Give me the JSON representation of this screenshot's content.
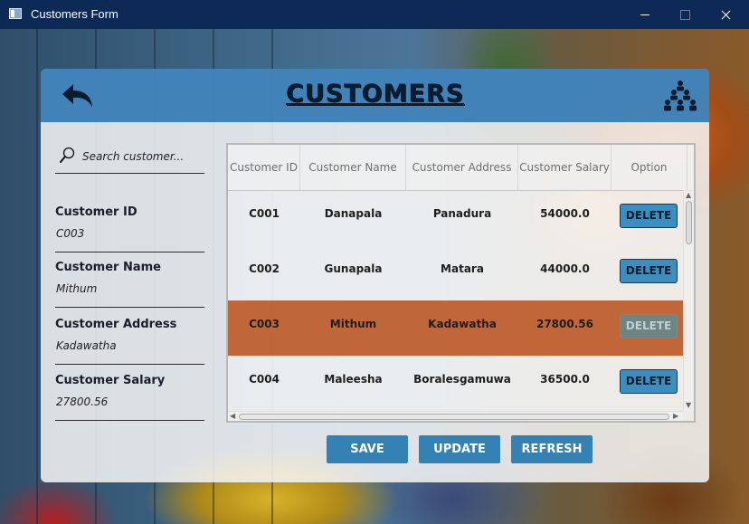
{
  "window": {
    "title": "Customers Form"
  },
  "header": {
    "title": "CUSTOMERS"
  },
  "search": {
    "placeholder": "Search customer..."
  },
  "form": {
    "id_label": "Customer ID",
    "id_value": "C003",
    "name_label": "Customer Name",
    "name_value": "Mithum",
    "address_label": "Customer Address",
    "address_value": "Kadawatha",
    "salary_label": "Customer Salary",
    "salary_value": "27800.56"
  },
  "table": {
    "columns": [
      "Customer ID",
      "Customer Name",
      "Customer Address",
      "Customer Salary",
      "Option"
    ],
    "rows": [
      {
        "id": "C001",
        "name": "Danapala",
        "address": "Panadura",
        "salary": "54000.0",
        "option": "DELETE"
      },
      {
        "id": "C002",
        "name": "Gunapala",
        "address": "Matara",
        "salary": "44000.0",
        "option": "DELETE"
      },
      {
        "id": "C003",
        "name": "Mithum",
        "address": "Kadawatha",
        "salary": "27800.56",
        "option": "DELETE"
      },
      {
        "id": "C004",
        "name": "Maleesha",
        "address": "Boralesgamuwa",
        "salary": "36500.0",
        "option": "DELETE"
      }
    ],
    "selected_row": 2
  },
  "buttons": {
    "save": "SAVE",
    "update": "UPDATE",
    "refresh": "REFRESH"
  },
  "colors": {
    "header": "#1e6eaf",
    "button": "#3482b4",
    "selected_row": "#b44008",
    "titlebar": "#0d2a57"
  },
  "icons": {
    "back": "back-arrow-icon",
    "users": "users-icon",
    "search": "search-icon"
  }
}
